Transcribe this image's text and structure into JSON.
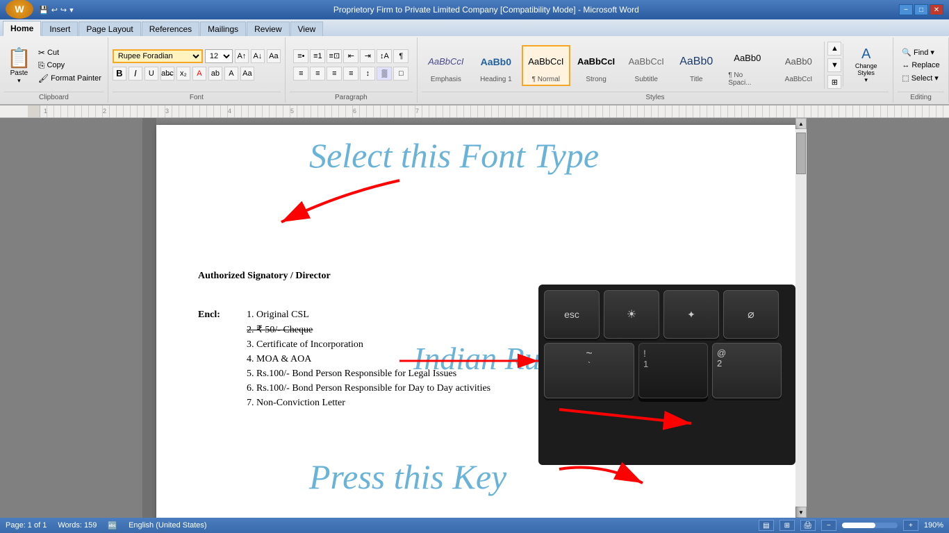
{
  "titlebar": {
    "title": "Proprietory Firm to Private Limited Company [Compatibility Mode] - Microsoft Word",
    "min": "−",
    "max": "□",
    "close": "✕"
  },
  "quickaccess": {
    "save": "💾",
    "undo": "↩",
    "redo": "↪"
  },
  "tabs": {
    "items": [
      "Home",
      "Insert",
      "Page Layout",
      "References",
      "Mailings",
      "Review",
      "View"
    ]
  },
  "ribbon": {
    "clipboard": {
      "paste": "Paste",
      "cut": "Cut",
      "copy": "Copy",
      "format_painter": "Format Painter",
      "label": "Clipboard"
    },
    "font": {
      "font_name": "Rupee Foradian",
      "font_size": "12",
      "label": "Font"
    },
    "paragraph": {
      "label": "Paragraph"
    },
    "styles": {
      "items": [
        {
          "name": "Emphasis",
          "label": "Emphasis"
        },
        {
          "name": "Heading 1",
          "label": "Heading 1"
        },
        {
          "name": "Normal",
          "label": "¶ Normal"
        },
        {
          "name": "Strong",
          "label": "Strong"
        },
        {
          "name": "Subtitle",
          "label": "Subtitle"
        },
        {
          "name": "Title",
          "label": "Title"
        },
        {
          "name": "No Spacing",
          "label": "¶ No Spaci..."
        },
        {
          "name": "AaBbCcI",
          "label": "AaBbCcI"
        }
      ],
      "label": "Styles"
    },
    "change_styles": {
      "label": "Change Styles"
    },
    "editing": {
      "find": "Find",
      "replace": "Replace",
      "select": "Select",
      "label": "Editing"
    }
  },
  "document": {
    "authorized": "Authorized Signatory / Director",
    "encl_label": "Encl:",
    "list_items": [
      "1.  Original CSL",
      "2.  ₹ 50/- Cheque",
      "3.  Certificate of Incorporation",
      "4.  MOA & AOA",
      "5.  Rs.100/- Bond Person Responsible for Legal Issues",
      "6.  Rs.100/- Bond Person Responsible for Day to Day activities",
      "7.  Non-Conviction Letter"
    ]
  },
  "annotations": {
    "select_font": "Select this Font Type",
    "indian_rupee": "Indian Rupee Symbol",
    "press_key": "Press this Key"
  },
  "statusbar": {
    "page": "Page: 1 of 1",
    "words": "Words: 159",
    "language": "English (United States)",
    "zoom": "190%"
  }
}
